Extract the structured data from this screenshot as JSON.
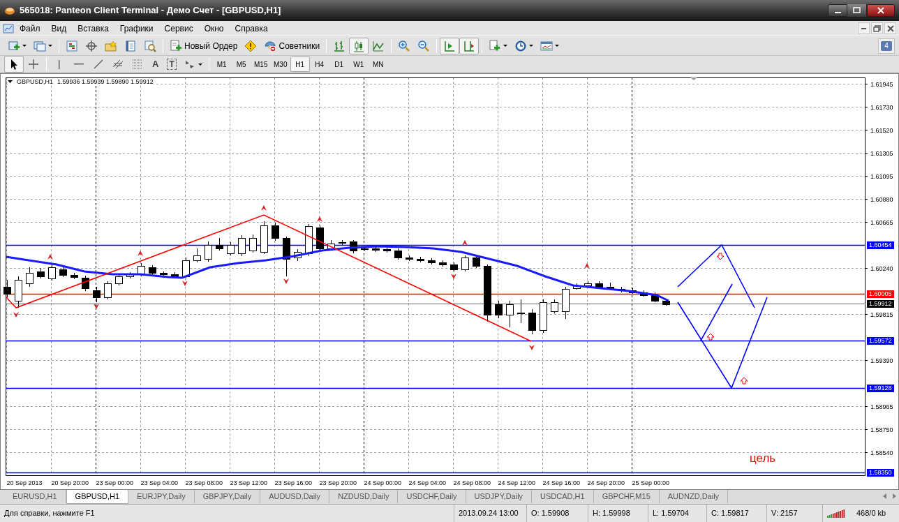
{
  "window": {
    "title": "565018: Panteon Client Terminal - Демо Счет - [GBPUSD,H1]"
  },
  "menu": [
    "Файл",
    "Вид",
    "Вставка",
    "Графики",
    "Сервис",
    "Окно",
    "Справка"
  ],
  "toolbar": {
    "new_order": "Новый Ордер",
    "experts": "Советники",
    "chart_types": [
      {
        "selected": false
      },
      {
        "selected": true
      },
      {
        "selected": false
      }
    ],
    "auto_scroll": {
      "on": true
    },
    "chart_shift": {
      "on": true
    },
    "notifications": "4"
  },
  "drawing_tools": {
    "tools": [
      {
        "selected": true
      },
      {
        "selected": false
      }
    ],
    "text_tool": "A",
    "text_label_tool": "T",
    "timeframes": [
      {
        "label": "M1",
        "selected": false
      },
      {
        "label": "M5",
        "selected": false
      },
      {
        "label": "M15",
        "selected": false
      },
      {
        "label": "M30",
        "selected": false
      },
      {
        "label": "H1",
        "selected": true
      },
      {
        "label": "H4",
        "selected": false
      },
      {
        "label": "D1",
        "selected": false
      },
      {
        "label": "W1",
        "selected": false
      },
      {
        "label": "MN",
        "selected": false
      }
    ]
  },
  "chart": {
    "header": {
      "symbol": "GBPUSD,H1",
      "values": "1.59936 1.59939 1.59890 1.59912"
    },
    "price_ticks": [
      "1.61945",
      "1.61730",
      "1.61520",
      "1.61305",
      "1.61095",
      "1.60880",
      "1.60665",
      "1.60240",
      "1.59815",
      "1.59390",
      "1.58965",
      "1.58750",
      "1.58540"
    ],
    "levels": [
      {
        "label": "1.60454",
        "color": "#0000ff"
      },
      {
        "label": "1.60005",
        "color": "#ff0000"
      },
      {
        "label": "1.59912",
        "color": "#000000"
      },
      {
        "label": "1.59572",
        "color": "#0000ff"
      },
      {
        "label": "1.59128",
        "color": "#0000ff"
      },
      {
        "label": "1.58350",
        "color": "#0000ff"
      }
    ],
    "time_labels": [
      "20 Sep 2013",
      "20 Sep 20:00",
      "23 Sep 00:00",
      "23 Sep 04:00",
      "23 Sep 08:00",
      "23 Sep 12:00",
      "23 Sep 16:00",
      "23 Sep 20:00",
      "24 Sep 00:00",
      "24 Sep 04:00",
      "24 Sep 08:00",
      "24 Sep 12:00",
      "24 Sep 16:00",
      "24 Sep 20:00",
      "25 Sep 00:00"
    ],
    "annotation": "цель"
  },
  "tabs": [
    {
      "label": "EURUSD,H1",
      "selected": false
    },
    {
      "label": "GBPUSD,H1",
      "selected": true
    },
    {
      "label": "EURJPY,Daily",
      "selected": false
    },
    {
      "label": "GBPJPY,Daily",
      "selected": false
    },
    {
      "label": "AUDUSD,Daily",
      "selected": false
    },
    {
      "label": "NZDUSD,Daily",
      "selected": false
    },
    {
      "label": "USDCHF,Daily",
      "selected": false
    },
    {
      "label": "USDJPY,Daily",
      "selected": false
    },
    {
      "label": "USDCAD,H1",
      "selected": false
    },
    {
      "label": "GBPCHF,M15",
      "selected": false
    },
    {
      "label": "AUDNZD,Daily",
      "selected": false
    }
  ],
  "status_bar": {
    "help": "Для справки, нажмите F1",
    "time": "2013.09.24 13:00",
    "open": "O: 1.59908",
    "high": "H: 1.59998",
    "low": "L: 1.59704",
    "close": "C: 1.59817",
    "volume": "V: 2157",
    "traffic": "468/0 kb"
  }
}
